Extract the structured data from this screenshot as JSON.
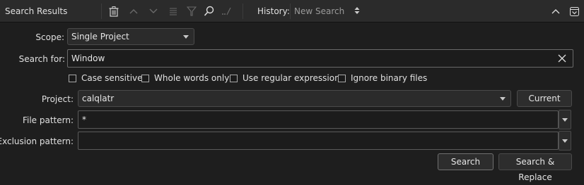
{
  "toolbar": {
    "title": "Search Results",
    "history_label": "History:",
    "history_value": "New Search",
    "icons": [
      "trash-icon",
      "up-arrow-icon",
      "down-arrow-icon",
      "list-icon",
      "filter-icon",
      "search-refresh-icon",
      "dot-dot-slash-icon",
      "chevron-up-icon",
      "collapse-panel-icon"
    ]
  },
  "form": {
    "scope_label": "Scope:",
    "scope_value": "Single Project",
    "search_for_label": "Search for:",
    "search_for_value": "Window",
    "options": [
      {
        "label": "Case sensitive",
        "checked": false
      },
      {
        "label": "Whole words only",
        "checked": false
      },
      {
        "label": "Use regular expressions",
        "checked": false
      },
      {
        "label": "Ignore binary files",
        "checked": false
      }
    ],
    "project_label": "Project:",
    "project_value": "calqlatr",
    "current_button": "Current",
    "file_pattern_label": "File pattern:",
    "file_pattern_value": "*",
    "exclusion_label": "Exclusion pattern:",
    "exclusion_value": "",
    "search_button": "Search",
    "search_replace_button": "Search & Replace"
  }
}
